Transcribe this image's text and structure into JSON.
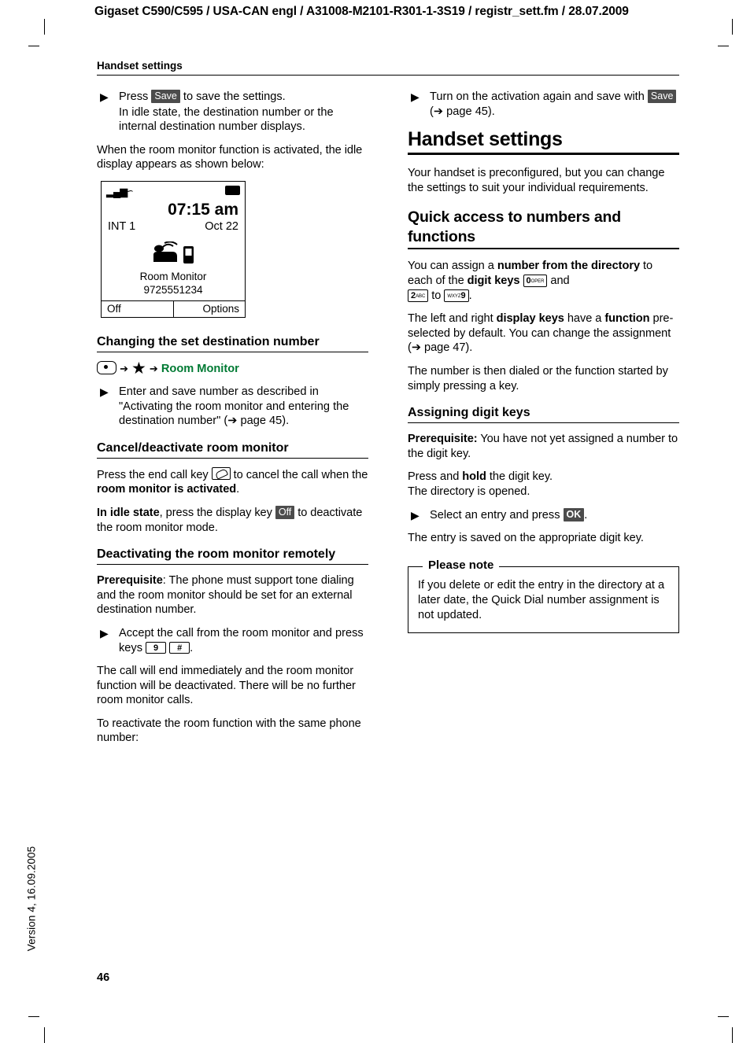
{
  "header": {
    "title": "Gigaset C590/C595 / USA-CAN engl / A31008-M2101-R301-1-3S19 / registr_sett.fm / 28.07.2009"
  },
  "side": {
    "version": "Version 4, 16.09.2005"
  },
  "runhead": "Handset settings",
  "pagenum": "46",
  "left_column": {
    "step_save": {
      "pre": "Press ",
      "key": "Save",
      "post": " to save the settings."
    },
    "step_save_cont": "In idle state, the destination number or the internal destination number displays.",
    "para_activated": "When the room monitor function is activated, the idle display appears as shown below:",
    "handset": {
      "signal_icon": "signal-bars-icon",
      "answering_icon": "answering-machine-icon",
      "battery_icon": "battery-icon",
      "time": "07:15 am",
      "int": "INT 1",
      "date": "Oct 22",
      "monitor_icon": "room-monitor-icon",
      "label": "Room Monitor",
      "number": "9725551234",
      "softkey_left": "Off",
      "softkey_right": "Options"
    },
    "h_changing": "Changing the set destination number",
    "path": {
      "nav": "nav-key-icon",
      "arrow1": "➔",
      "star": "★",
      "arrow2": "➔",
      "menu": "Room Monitor"
    },
    "step_enter": "Enter and save number as described in \"Activating the room monitor and entering the destination number\" (",
    "step_enter_page": "page 45).",
    "h_cancel": "Cancel/deactivate room monitor",
    "p_cancel_a": "Press the end call key ",
    "p_cancel_b": " to cancel the call when the ",
    "p_cancel_bold": "room monitor is activated",
    "p_cancel_c": ".",
    "p_idle_bold": "In idle state",
    "p_idle_a": ", press the display key ",
    "p_idle_key": "Off",
    "p_idle_b": " to deactivate the room monitor mode.",
    "h_deact_remote": "Deactivating the room monitor remotely",
    "p_prereq_bold": "Prerequisite",
    "p_prereq": ": The phone must support tone dialing and the room monitor should be set for an external destination number.",
    "step_accept": "Accept the call from the room monitor and press keys ",
    "step_accept_key1": "9",
    "step_accept_key2": "#",
    "step_accept_end": ".",
    "p_callend": "The call will end immediately and the room monitor function will be deactivated. There will be no further room monitor calls.",
    "p_reactivate": "To reactivate the room function with the same phone number:"
  },
  "right_column": {
    "step_turnon": "Turn on the activation again and save with ",
    "step_turnon_key": "Save",
    "step_turnon_page": "page 45).",
    "h_handset_settings": "Handset settings",
    "p_preconfigured": "Your handset is preconfigured, but you can change the settings to suit your individual requirements.",
    "h_quick_access": "Quick access to numbers and functions",
    "p_assign_a": "You can assign a ",
    "p_assign_bold1": "number from the directory",
    "p_assign_b": " to each of the ",
    "p_assign_bold2": "digit keys",
    "p_assign_key0_big": "0",
    "p_assign_key0_sml": "OPER",
    "p_assign_c": " and ",
    "p_assign_key2_big": "2",
    "p_assign_key2_sml": "ABC",
    "p_assign_d": " to ",
    "p_assign_key9_big": "9",
    "p_assign_key9_sml": "WXYZ",
    "p_assign_e": ".",
    "p_displaykeys_a": "The left and right ",
    "p_displaykeys_bold1": "display keys",
    "p_displaykeys_b": " have a ",
    "p_displaykeys_bold2": "function",
    "p_displaykeys_c": " pre-selected by default. You can change the assignment (",
    "p_displaykeys_page": "page 47).",
    "p_dialed": "The number is then dialed or the function started by simply pressing a key.",
    "h_assigning": "Assigning digit keys",
    "p_prereq_bold": "Prerequisite:",
    "p_prereq": " You have not yet assigned a number to the digit key.",
    "p_presshold_a": "Press and ",
    "p_presshold_bold": "hold",
    "p_presshold_b": " the digit key.",
    "p_presshold_c": "The directory is opened.",
    "step_select": "Select an entry and press ",
    "step_select_key": "OK",
    "step_select_end": ".",
    "p_saved": "The entry is saved on the appropriate digit key.",
    "note": {
      "title": "Please note",
      "body": "If you delete or edit the entry in the directory at a later date, the Quick Dial number assignment is not updated."
    }
  }
}
